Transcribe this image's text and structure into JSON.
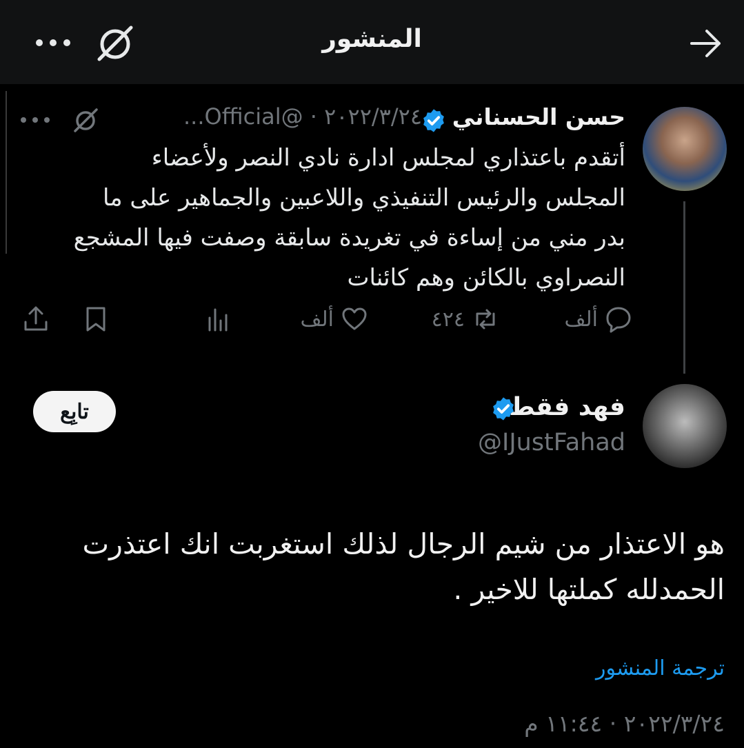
{
  "header": {
    "title": "المنشور",
    "back_icon": "arrow-right-icon",
    "grok_icon": "grok-icon",
    "more_icon": "more-horizontal-icon"
  },
  "quoted_post": {
    "author_name": "حسن الحسناني",
    "verified": true,
    "meta": "...Official@ · ٢٠٢٢/٣/٢٤",
    "body_lines": [
      "أتقدم باعتذاري لمجلس ادارة نادي النصر ولأعضاء",
      "المجلس والرئيس التنفيذي واللاعبين والجماهير على ما",
      "بدر مني من إساءة في تغريدة سابقة وصفت فيها المشجع",
      "النصراوي بالكائن وهم كائنات"
    ],
    "actions": {
      "replies": "ألف",
      "reposts": "٤٢٤",
      "likes": "ألف"
    }
  },
  "reply_post": {
    "author_name": "فهد فقط.",
    "verified": true,
    "handle": "@IJustFahad",
    "follow_label": "تابِع",
    "body_lines": [
      "هو الاعتذار من شيم الرجال لذلك استغربت انك اعتذرت",
      "الحمدلله كملتها للاخير ."
    ],
    "translate_label": "ترجمة المنشور",
    "timestamp": "٢٠٢٢/٣/٢٤ · ١١:٤٤ م"
  },
  "colors": {
    "background": "#000000",
    "header_bg": "#111213",
    "muted": "#71767b",
    "link": "#1d9bf0",
    "verified": "#1d9bf0"
  }
}
